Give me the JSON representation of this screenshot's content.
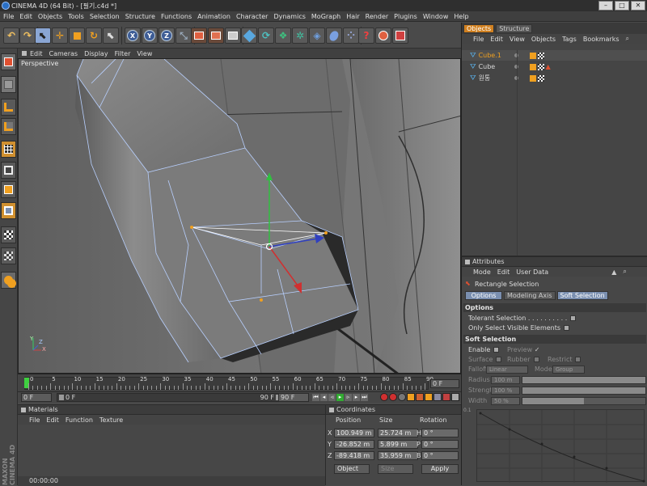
{
  "window": {
    "title": "CINEMA 4D (64 Bit) - [필기.c4d *]",
    "min": "–",
    "max": "□",
    "close": "✕"
  },
  "menu": [
    "File",
    "Edit",
    "Objects",
    "Tools",
    "Selection",
    "Structure",
    "Functions",
    "Animation",
    "Character",
    "Dynamics",
    "MoGraph",
    "Hair",
    "Render",
    "Plugins",
    "Window",
    "Help"
  ],
  "toolbar_icons": [
    "undo-icon",
    "redo-icon",
    "live-selection-icon",
    "move-icon",
    "scale-icon",
    "rotate-icon",
    "last-tool-icon",
    "x-axis-icon",
    "y-axis-icon",
    "z-axis-icon",
    "coordinate-system-icon",
    "render-view-icon",
    "render-picture-viewer-icon",
    "edit-render-settings-icon",
    "cube-icon",
    "bend-icon",
    "hyper-nurbs-icon",
    "array-icon",
    "boole-icon",
    "light-icon",
    "environment-icon",
    "camera-icon",
    "help-icon",
    "layer-browser-icon",
    "snap-icon"
  ],
  "toolbar_letters": {
    "x": "X",
    "y": "Y",
    "z": "Z"
  },
  "viewport": {
    "menu": [
      "Edit",
      "Cameras",
      "Display",
      "Filter",
      "View"
    ],
    "label": "Perspective",
    "axes": {
      "x": "X",
      "y": "Y",
      "z": "Z"
    }
  },
  "timeline": {
    "ticks": [
      "0",
      "5",
      "10",
      "15",
      "20",
      "25",
      "30",
      "35",
      "40",
      "45",
      "50",
      "55",
      "60",
      "65",
      "70",
      "75",
      "80",
      "85",
      "90"
    ],
    "current_frame": "0 F",
    "start_frame": "0 F",
    "preview_start": "0 F",
    "preview_end": "90 F",
    "end_frame": "90 F"
  },
  "materials": {
    "title": "Materials",
    "menu": [
      "File",
      "Edit",
      "Function",
      "Texture"
    ]
  },
  "coordinates": {
    "title": "Coordinates",
    "headers": [
      "Position",
      "Size",
      "Rotation"
    ],
    "rows": [
      {
        "axis": "X",
        "pos": "100.949 m",
        "size": "25.724 m",
        "rlabel": "H",
        "rot": "0 °"
      },
      {
        "axis": "Y",
        "pos": "-26.852 m",
        "size": "5.899 m",
        "rlabel": "P",
        "rot": "0 °"
      },
      {
        "axis": "Z",
        "pos": "-89.418 m",
        "size": "35.959 m",
        "rlabel": "B",
        "rot": "0 °"
      }
    ],
    "mode": "Object",
    "size_mode": "Size",
    "apply": "Apply"
  },
  "objects": {
    "tabs": [
      "Objects",
      "Structure"
    ],
    "menu": [
      "File",
      "Edit",
      "View",
      "Objects",
      "Tags",
      "Bookmarks"
    ],
    "items": [
      {
        "name": "Cube.1",
        "selected": true
      },
      {
        "name": "Cube",
        "selected": false
      },
      {
        "name": "원통",
        "selected": false
      }
    ]
  },
  "attributes": {
    "title": "Attributes",
    "menu": [
      "Mode",
      "Edit",
      "User Data"
    ],
    "tool_name": "Rectangle Selection",
    "tabs": [
      "Options",
      "Modeling Axis",
      "Soft Selection"
    ],
    "options_header": "Options",
    "tolerant": "Tolerant Selection",
    "tolerant_dots": " . . . . . . . . . .",
    "only_visible": "Only Select Visible Elements",
    "soft_header": "Soft Selection",
    "enable": "Enable",
    "preview": "Preview",
    "preview_check": "✓",
    "surface": "Surface",
    "rubber": "Rubber",
    "restrict": "Restrict",
    "falloff_label": "Falloff",
    "falloff_value": "Linear",
    "mode_label": "Mode",
    "mode_value": "Group",
    "radius_label": "Radius",
    "radius_value": "100 m",
    "strength_label": "Strength",
    "strength_value": "100 %",
    "width_label": "Width",
    "width_value": "50 %",
    "graph_tick": "0.1"
  },
  "bottom": {
    "status_time": "00:00:00",
    "brand_line1": "MAXON",
    "brand_line2": "CINEMA 4D"
  },
  "colors": {
    "accent": "#f0a020",
    "selected_tab": "#7a8fb0",
    "viewport_bg": "#6b6b6b",
    "wire": "#b8d0ff"
  }
}
